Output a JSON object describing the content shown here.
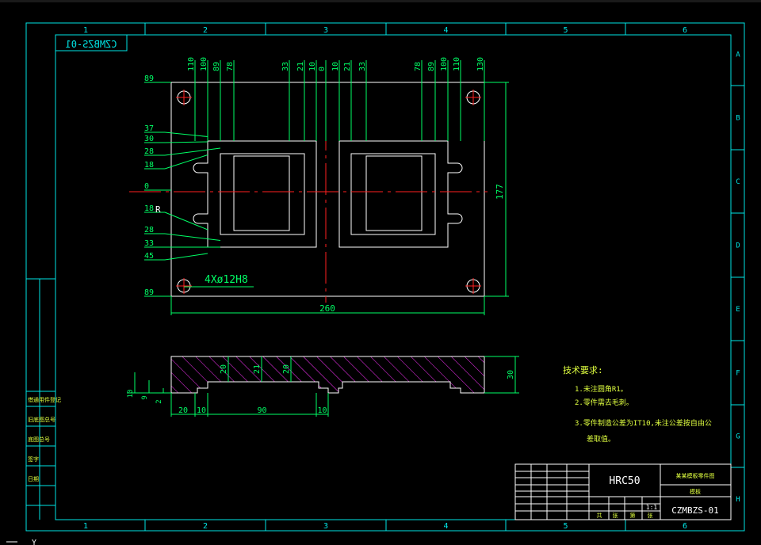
{
  "colors": {
    "background": "#000000",
    "frame": "#00e5e5",
    "outline": "#ffffff",
    "dimension": "#00ff66",
    "centerline": "#ff2020",
    "hatch": "#ff33ff",
    "text_yellow": "#e0ff40"
  },
  "border": {
    "columns_top": [
      "1",
      "2",
      "3",
      "4",
      "5",
      "6"
    ],
    "columns_bottom": [
      "1",
      "2",
      "3",
      "4",
      "5",
      "6"
    ],
    "rows": [
      "A",
      "B",
      "C",
      "D",
      "E",
      "F",
      "G",
      "H"
    ]
  },
  "mirrored_code": "CZMBZS-01",
  "plan_view": {
    "top_dims": [
      "110",
      "100",
      "89",
      "78",
      "33",
      "21",
      "10",
      "0",
      "10",
      "21",
      "33",
      "78",
      "89",
      "100",
      "110",
      "130"
    ],
    "left_dims": [
      "89",
      "37",
      "30",
      "28",
      "18",
      "0",
      "18",
      "28",
      "33",
      "45",
      "89"
    ],
    "r_label": "R",
    "hole_callout": "4Xø12H8",
    "width_dim": "260",
    "height_dim": "177"
  },
  "section_view": {
    "pocket_depths": [
      "20",
      "21",
      "20"
    ],
    "thickness": "30",
    "left_small": [
      "10",
      "9",
      "2"
    ],
    "bottom_dims": [
      "20",
      "10",
      "90",
      "10"
    ]
  },
  "tech_notes": {
    "title": "技术要求:",
    "lines": [
      "1.未注圆角R1。",
      "2.零件需去毛刺。",
      "3.零件制造公差为IT10,未注公差按自由公",
      "差取值。"
    ]
  },
  "title_block": {
    "hardness": "HRC50",
    "part_name": "某某模板零件图",
    "material": "模板",
    "scale": "1:1",
    "drawing_no": "CZMBZS-01",
    "sheet_labels": [
      "共",
      "张",
      "第",
      "张"
    ]
  },
  "side_strip": {
    "labels": [
      "借通用件登记",
      "旧底图总号",
      "底图总号",
      "签字",
      "日期"
    ]
  },
  "status": {
    "axis_hint": "Y"
  }
}
